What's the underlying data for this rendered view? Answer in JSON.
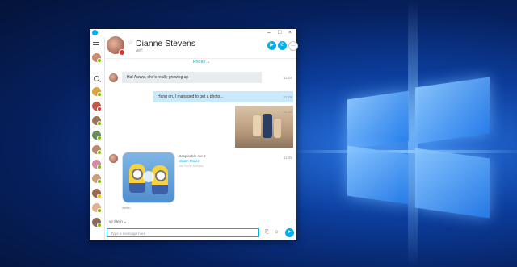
{
  "window": {
    "controls": {
      "minimize": "–",
      "maximize": "□",
      "close": "×"
    }
  },
  "header": {
    "name": "Dianne Stevens",
    "status_text": "Ain!"
  },
  "chat": {
    "day_label": "Friday ⌄",
    "messages": [
      {
        "text": "Ha! Awww, she's really growing up",
        "time": "11:04"
      },
      {
        "text": "Hang on, I managed to get a photo...",
        "time": "11:05"
      },
      {
        "time": "11:05"
      },
      {
        "time": "11:05"
      }
    ],
    "gif": {
      "title": "Despicable me 2",
      "link": "Watch Movie",
      "via": "via Giphy Movies"
    },
    "seen_label": "Seen",
    "typing_label": "ve Stern ⌄"
  },
  "composer": {
    "placeholder": "Type a message here"
  },
  "colors": {
    "accent": "#00aff0",
    "status_busy": "#d9342b",
    "status_online": "#7cbb00"
  }
}
